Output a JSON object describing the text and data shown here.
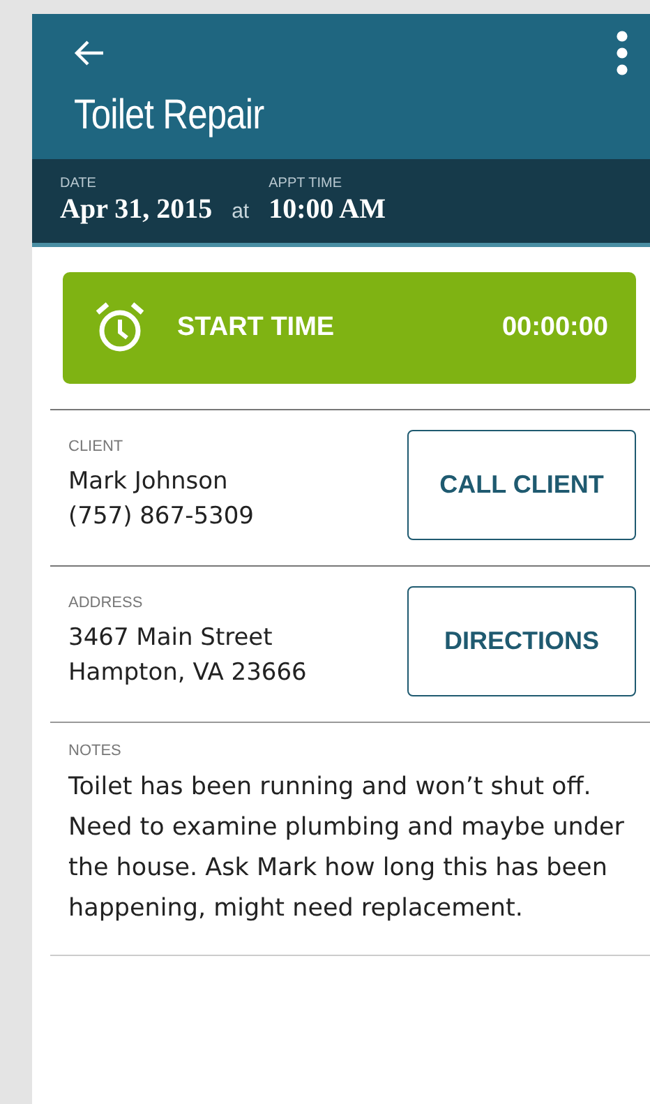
{
  "app_bar": {
    "title": "Toilet Repair"
  },
  "appointment": {
    "date_label": "DATE",
    "date": "Apr 31, 2015",
    "joiner": "at",
    "time_label": "APPT TIME",
    "time": "10:00 AM"
  },
  "timer": {
    "label": "START TIME",
    "elapsed": "00:00:00"
  },
  "sections": [
    {
      "label": "CLIENT",
      "lines": [
        "Mark Johnson",
        "(757) 867-5309"
      ],
      "action": "CALL CLIENT"
    },
    {
      "label": "ADDRESS",
      "lines": [
        "3467 Main Street",
        "Hampton, VA 23666"
      ],
      "action": "DIRECTIONS"
    }
  ],
  "notes": {
    "label": "NOTES",
    "text": "Toilet has been running and won’t shut off. Need to examine plumbing and maybe under the house. Ask Mark how long this has been happening, might need replacement."
  }
}
